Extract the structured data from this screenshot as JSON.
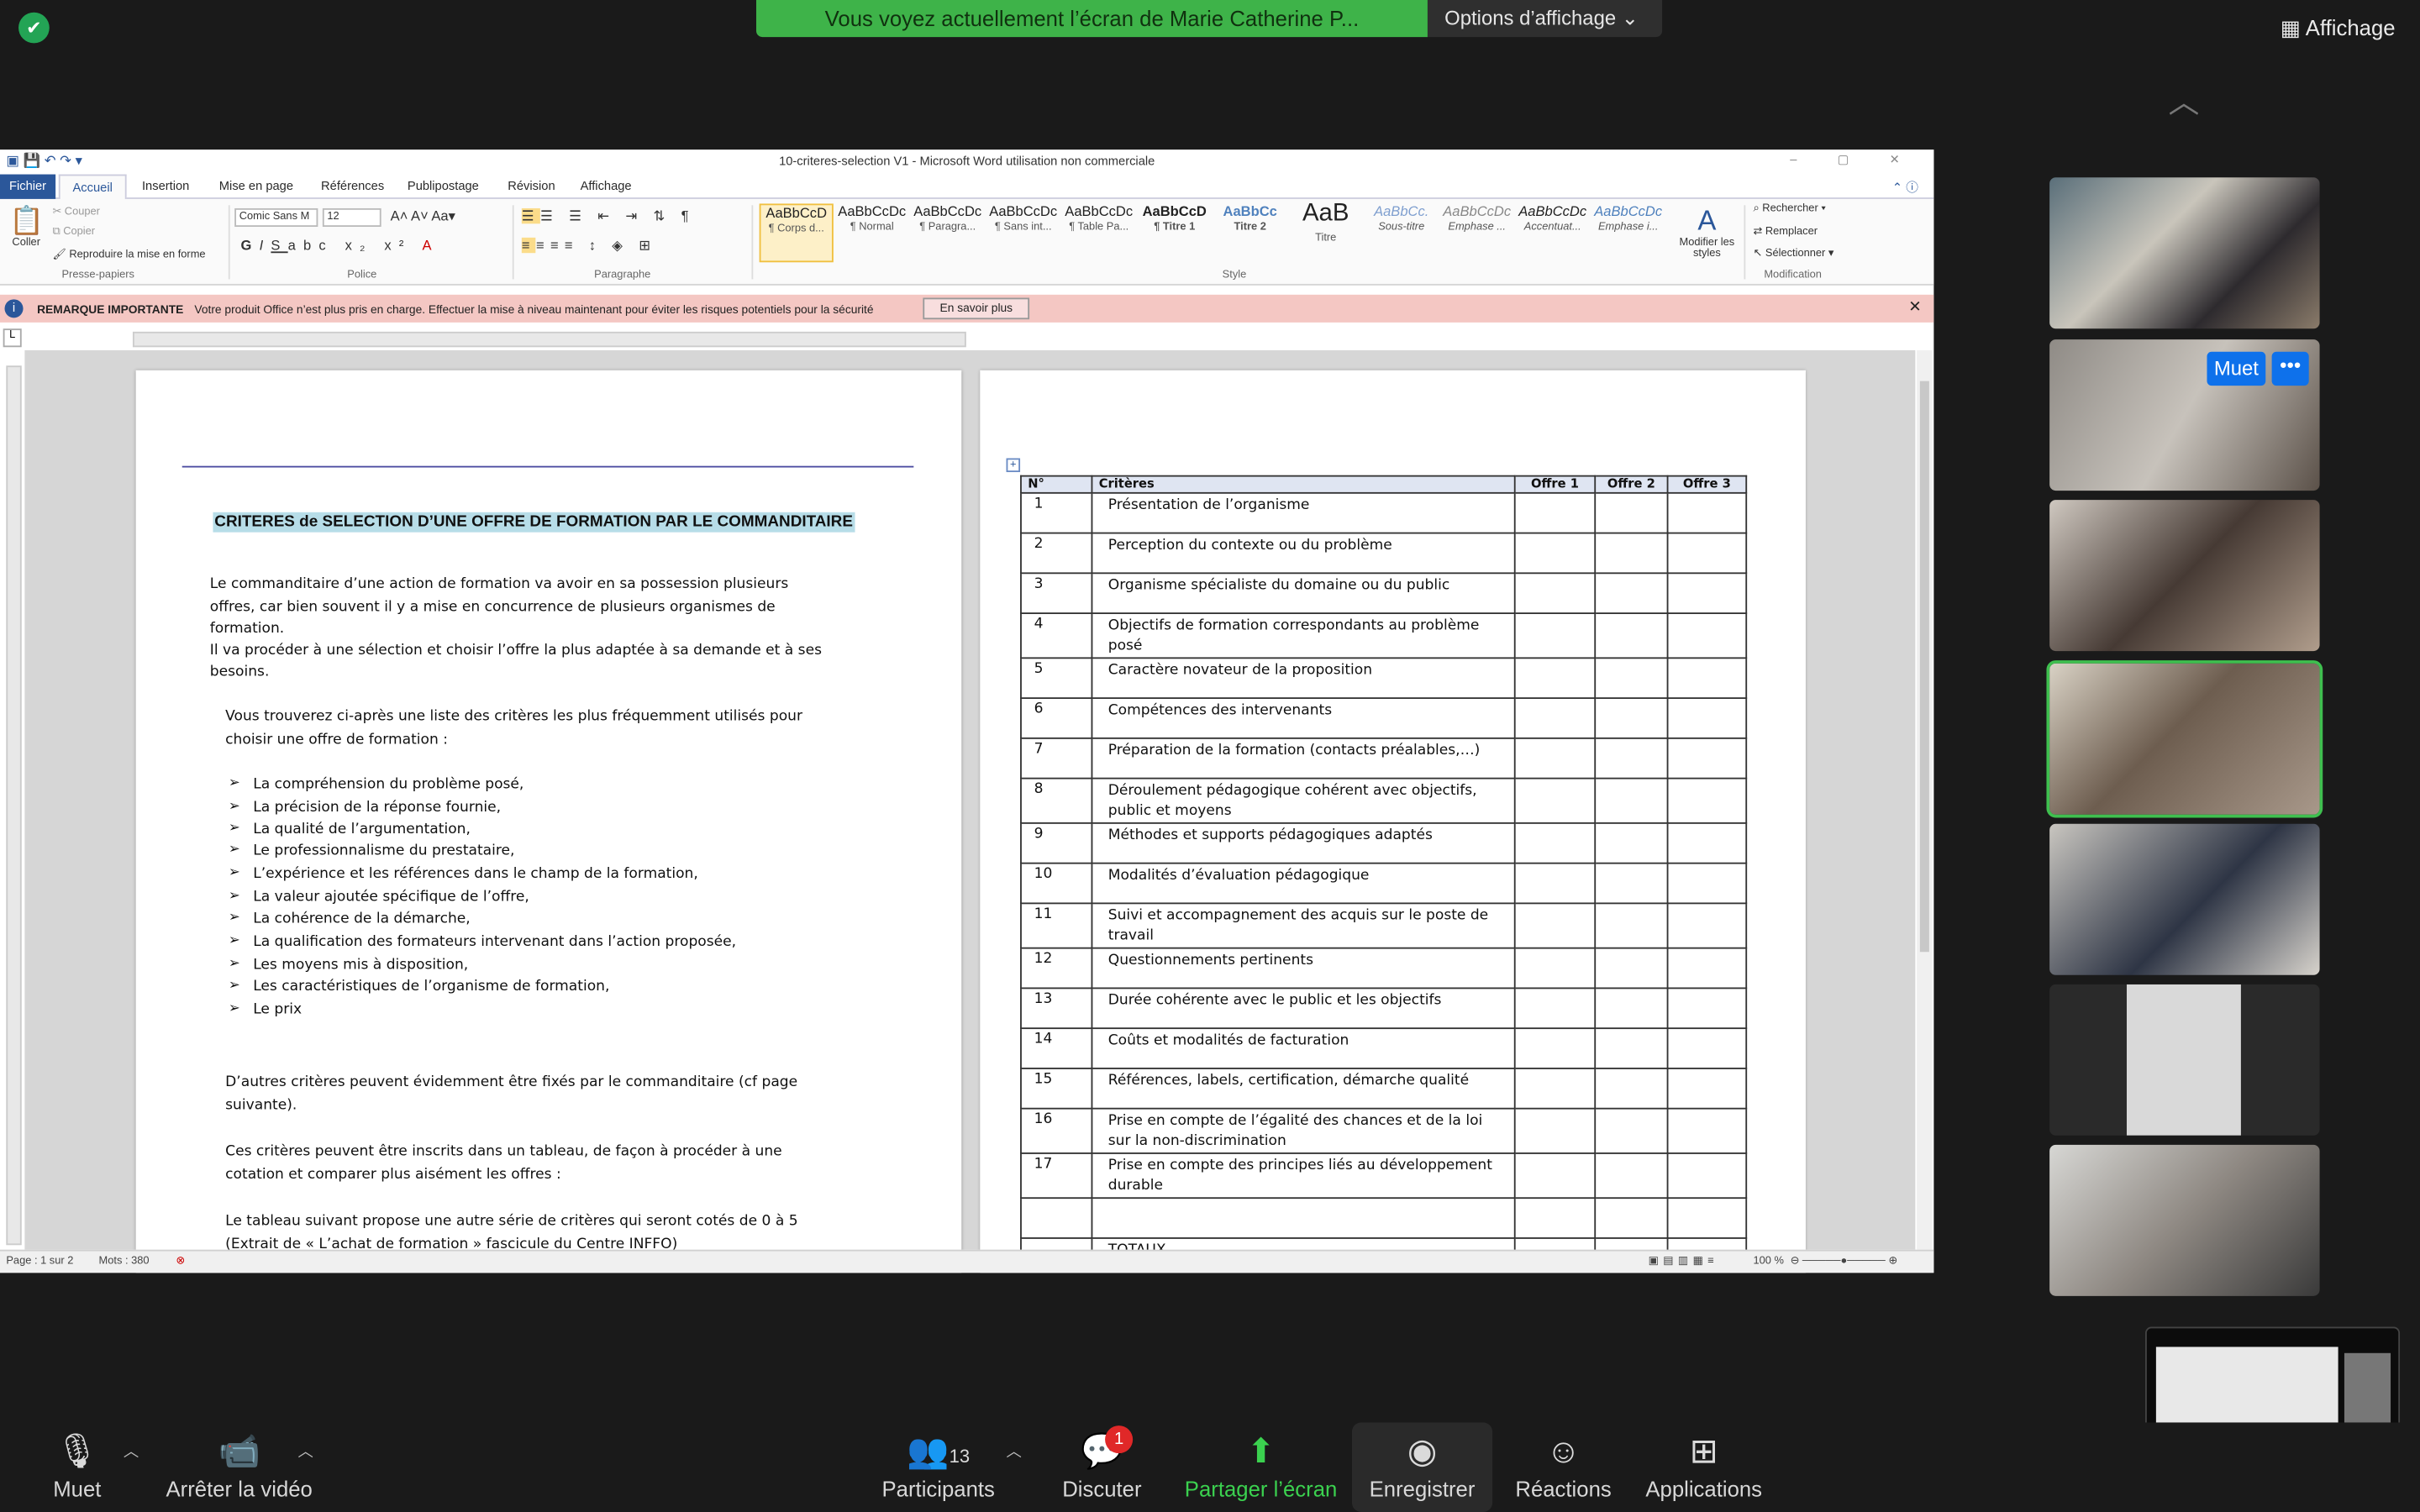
{
  "zoom": {
    "share_banner": "Vous voyez actuellement l’écran de Marie Catherine P...",
    "view_options": "Options d’affichage",
    "affichage": "Affichage",
    "toolbar": {
      "mute": "Muet",
      "stop_video": "Arrêter la vidéo",
      "participants": "Participants",
      "participants_count": "13",
      "chat": "Discuter",
      "chat_badge": "1",
      "share": "Partager l’écran",
      "record": "Enregistrer",
      "reactions": "Réactions",
      "apps": "Applications"
    },
    "thumb_mute_tag": "Muet",
    "thumb_more_tag": "•••"
  },
  "word": {
    "title": "10-criteres-selection V1  -  Microsoft Word utilisation non commerciale",
    "tabs": [
      "Fichier",
      "Accueil",
      "Insertion",
      "Mise en page",
      "Références",
      "Publipostage",
      "Révision",
      "Affichage"
    ],
    "clipboard": {
      "paste": "Coller",
      "cut": "Couper",
      "copy": "Copier",
      "format_painter": "Reproduire la mise en forme",
      "group": "Presse-papiers"
    },
    "font": {
      "name": "Comic Sans M",
      "size": "12",
      "group": "Police"
    },
    "paragraph_group": "Paragraphe",
    "style_group": "Style",
    "modify_styles": "Modifier les styles",
    "editing": {
      "find": "Rechercher",
      "replace": "Remplacer",
      "select": "Sélectionner",
      "group": "Modification"
    },
    "styles": [
      {
        "preview": "AaBbCcD",
        "name": "¶ Corps d..."
      },
      {
        "preview": "AaBbCcDc",
        "name": "¶ Normal"
      },
      {
        "preview": "AaBbCcDc",
        "name": "¶ Paragra..."
      },
      {
        "preview": "AaBbCcDc",
        "name": "¶ Sans int..."
      },
      {
        "preview": "AaBbCcDc",
        "name": "¶ Table Pa..."
      },
      {
        "preview": "AaBbCcD",
        "name": "¶ Titre 1"
      },
      {
        "preview": "AaBbCc",
        "name": "Titre 2"
      },
      {
        "preview": "AaB",
        "name": "Titre"
      },
      {
        "preview": "AaBbCc.",
        "name": "Sous-titre"
      },
      {
        "preview": "AaBbCcDc",
        "name": "Emphase ..."
      },
      {
        "preview": "AaBbCcDc",
        "name": "Accentuat..."
      },
      {
        "preview": "AaBbCcDc",
        "name": "Emphase i..."
      }
    ],
    "notice": {
      "label": "REMARQUE IMPORTANTE",
      "text": "Votre produit Office n’est plus pris en charge. Effectuer la mise à niveau maintenant pour éviter les risques potentiels pour la sécurité",
      "button": "En savoir plus"
    },
    "status": {
      "page": "Page : 1 sur 2",
      "words": "Mots : 380",
      "zoom": "100 %"
    },
    "page1": {
      "title": "CRITERES de SELECTION D’UNE  OFFRE DE FORMATION PAR LE COMMANDITAIRE",
      "intro": [
        "Le commanditaire  d’une action de formation va avoir en sa possession plusieurs",
        "offres, car bien souvent il y a mise en concurrence de plusieurs organismes de",
        "formation.",
        "Il va procéder à une sélection et choisir l’offre la plus adaptée à sa demande et à ses",
        "besoins."
      ],
      "list_intro": [
        "Vous trouverez ci-après une liste des critères les plus fréquemment utilisés pour",
        "choisir une offre de formation :"
      ],
      "bullets": [
        "La compréhension du problème posé,",
        "La précision de la réponse fournie,",
        "La qualité de l’argumentation,",
        "Le professionnalisme du prestataire,",
        "L’expérience et les références dans le champ de la formation,",
        "La valeur ajoutée spécifique de l’offre,",
        "La cohérence de la démarche,",
        "La qualification des formateurs intervenant dans l’action proposée,",
        "Les moyens mis à disposition,",
        "Les caractéristiques de l’organisme de formation,",
        "Le prix"
      ],
      "p_other": [
        "D’autres critères peuvent évidemment être fixés par le commanditaire (cf page",
        "suivante)."
      ],
      "p_table": [
        "Ces critères peuvent être inscrits dans un tableau, de façon à procéder à une",
        "cotation et comparer plus aisément les offres :"
      ],
      "p_last": [
        "Le tableau suivant propose une autre série de critères qui seront cotés de 0 à 5",
        "(Extrait de « L’achat de formation » fascicule du Centre INFFO)"
      ]
    },
    "table": {
      "headers": [
        "N°",
        "Critères",
        "Offre 1",
        "Offre 2",
        "Offre 3"
      ],
      "rows": [
        [
          "1",
          "Présentation de l’organisme"
        ],
        [
          "2",
          "Perception du contexte ou du problème"
        ],
        [
          "3",
          "Organisme spécialiste du domaine ou du public"
        ],
        [
          "4",
          "Objectifs de formation correspondants au problème posé"
        ],
        [
          "5",
          "Caractère novateur de la proposition"
        ],
        [
          "6",
          "Compétences des intervenants"
        ],
        [
          "7",
          "Préparation de la formation (contacts préalables,…)"
        ],
        [
          "8",
          "Déroulement pédagogique cohérent avec objectifs, public et moyens"
        ],
        [
          "9",
          "Méthodes et supports pédagogiques adaptés"
        ],
        [
          "10",
          "Modalités d’évaluation pédagogique"
        ],
        [
          "11",
          "Suivi et accompagnement des acquis sur le poste de travail"
        ],
        [
          "12",
          "Questionnements pertinents"
        ],
        [
          "13",
          "Durée cohérente avec le public et les objectifs"
        ],
        [
          "14",
          "Coûts et modalités de facturation"
        ],
        [
          "15",
          "Références, labels, certification, démarche qualité"
        ],
        [
          "16",
          "Prise en compte de l’égalité des chances et de la loi sur la non-discrimination"
        ],
        [
          "17",
          "Prise en compte des principes liés au développement durable"
        ],
        [
          "",
          ""
        ],
        [
          "",
          "TOTAUX"
        ]
      ]
    }
  }
}
